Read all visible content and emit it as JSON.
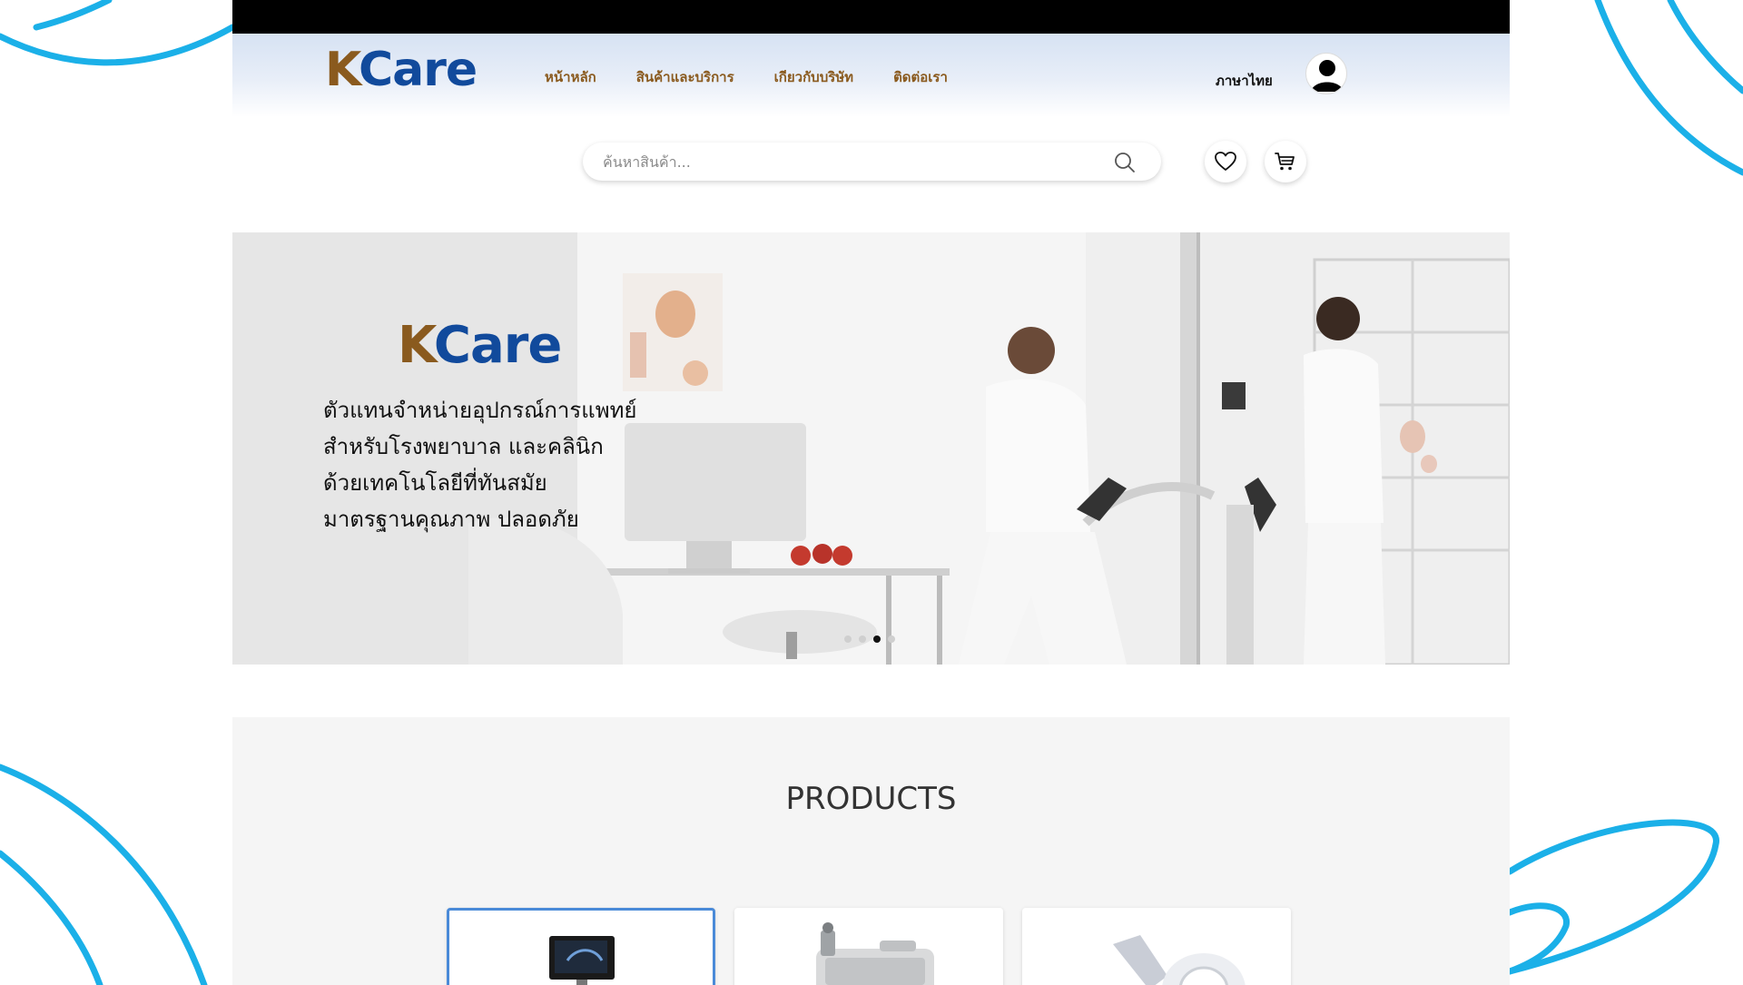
{
  "brand": {
    "k": "K",
    "care": "Care"
  },
  "nav": {
    "items": [
      {
        "label": "หน้าหลัก"
      },
      {
        "label": "สินค้าและบริการ"
      },
      {
        "label": "เกียวกับบริษัท"
      },
      {
        "label": "ติดต่อเรา"
      }
    ],
    "language": "ภาษาไทย"
  },
  "search": {
    "placeholder": "ค้นหาสินค้า..."
  },
  "icons": {
    "search": "search-icon",
    "wishlist": "heart-icon",
    "cart": "cart-icon",
    "user": "user-icon"
  },
  "hero": {
    "logo_k": "K",
    "logo_care": "Care",
    "lines": [
      "ตัวแทนจำหน่ายอุปกรณ์การแพทย์",
      "สำหรับโรงพยาบาล และคลินิก",
      "ด้วยเทคโนโลยีที่ทันสมัย",
      "มาตรฐานคุณภาพ ปลอดภัย"
    ],
    "slides_total": 4,
    "active_slide": 3
  },
  "products": {
    "title": "PRODUCTS",
    "cards": [
      {
        "product": "ultrasound-machine",
        "selected": true
      },
      {
        "product": "suction-device",
        "selected": false
      },
      {
        "product": "treadmill-scanner",
        "selected": false
      }
    ]
  },
  "colors": {
    "brand_brown": "#8a5a1e",
    "brand_blue": "#114a9c",
    "deco_blue": "#1bb0e8",
    "selected_border": "#4a8ad8"
  }
}
